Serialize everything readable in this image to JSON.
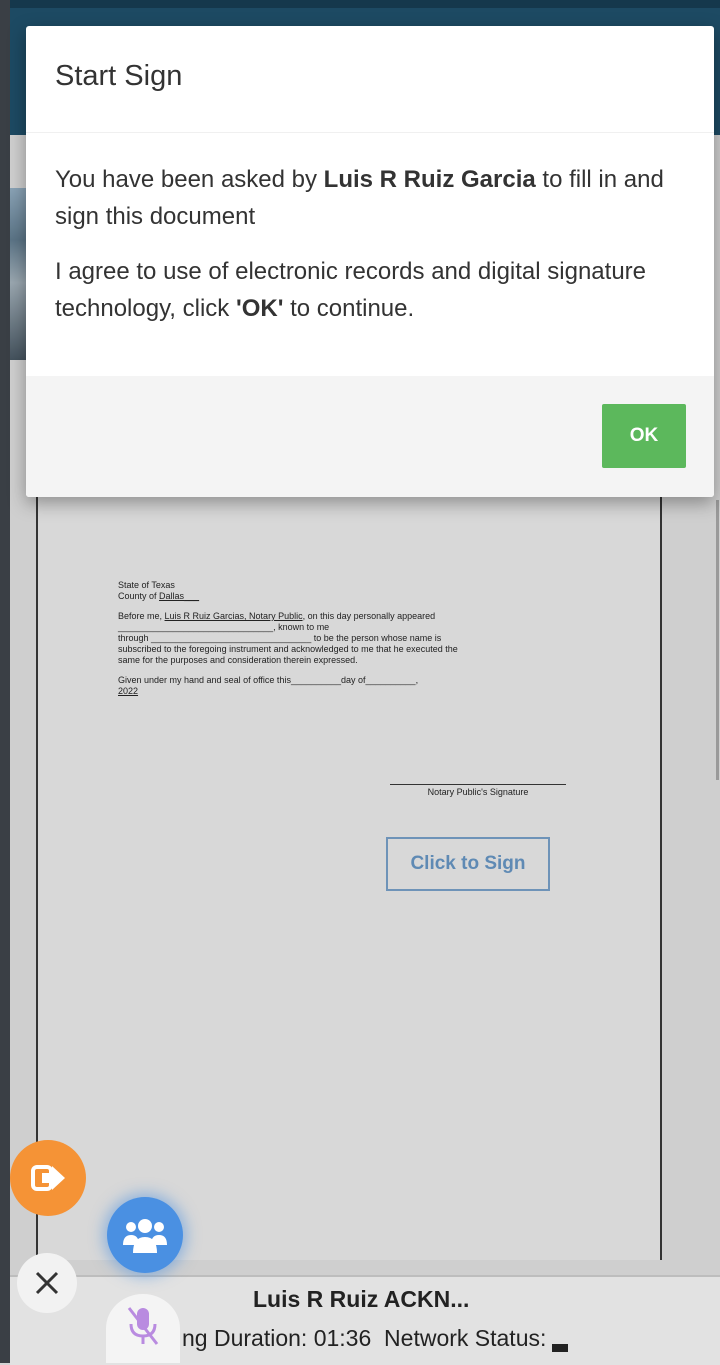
{
  "modal": {
    "title": "Start Sign",
    "intro_prefix": "You have been asked by ",
    "requester_name": "Luis R Ruiz Garcia",
    "intro_suffix": " to fill in and sign this document",
    "consent_prefix": "I agree to use of electronic records and digital signature technology, click ",
    "consent_ok": "'OK'",
    "consent_suffix": " to continue.",
    "ok_label": "OK"
  },
  "document": {
    "state_line": "State of Texas",
    "county_prefix": "County of ",
    "county_name": "Dallas",
    "county_trail": "___",
    "para1_prefix": "Before me, ",
    "para1_notary": "Luis R Ruiz Garcias, Notary Public",
    "para1_suffix": ", on this day personally appeared",
    "para1_line2": "_______________________________, known to me",
    "para1_line3": "through ________________________________ to be the person whose name is",
    "para1_line4": "subscribed to the foregoing instrument and acknowledged to me that he executed the",
    "para1_line5": "same for the purposes and consideration therein expressed.",
    "para2_line1": "Given under my hand and seal of office this__________day of__________,",
    "para2_year": "2022",
    "signature_label": "Notary Public's Signature",
    "click_to_sign": "Click to Sign"
  },
  "call": {
    "title": "Luis R Ruiz ACKN...",
    "duration_label": "ng Duration: ",
    "duration_value": "01:36",
    "network_label": "Network Status:"
  },
  "icons": {
    "exit": "exit-icon",
    "participants": "users-icon",
    "close": "close-icon",
    "mic": "mic-off-icon"
  },
  "colors": {
    "header": "#1d4a63",
    "ok_button": "#5cb85c",
    "exit_button": "#f59336",
    "participants_button": "#4a90e2",
    "sign_button": "#6e93b8"
  }
}
